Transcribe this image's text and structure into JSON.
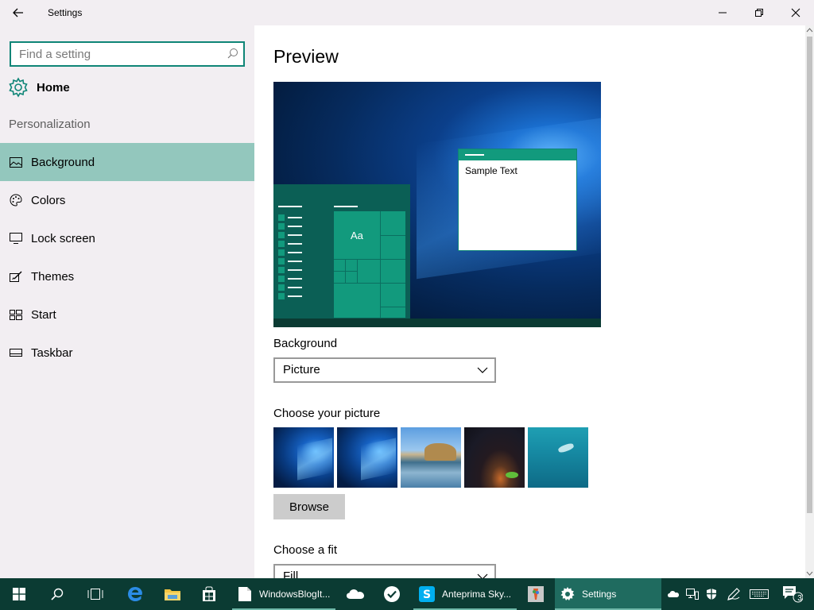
{
  "window": {
    "title": "Settings",
    "back_icon": "back-arrow-icon",
    "minimize_icon": "minimize-icon",
    "restore_icon": "restore-icon",
    "close_icon": "close-icon"
  },
  "sidebar": {
    "search_placeholder": "Find a setting",
    "home_label": "Home",
    "section_title": "Personalization",
    "items": [
      {
        "label": "Background",
        "icon": "picture-icon",
        "active": true
      },
      {
        "label": "Colors",
        "icon": "palette-icon",
        "active": false
      },
      {
        "label": "Lock screen",
        "icon": "monitor-icon",
        "active": false
      },
      {
        "label": "Themes",
        "icon": "brush-icon",
        "active": false
      },
      {
        "label": "Start",
        "icon": "start-tiles-icon",
        "active": false
      },
      {
        "label": "Taskbar",
        "icon": "taskbar-icon",
        "active": false
      }
    ]
  },
  "main": {
    "heading": "Preview",
    "preview_sample_text": "Sample Text",
    "preview_tile_text": "Aa",
    "background_label": "Background",
    "background_value": "Picture",
    "choose_picture_label": "Choose your picture",
    "browse_label": "Browse",
    "choose_fit_label": "Choose a fit",
    "fit_value": "Fill"
  },
  "taskbar": {
    "apps": [
      {
        "label": "WindowsBlogIt...",
        "icon": "document-icon"
      },
      {
        "label": "Anteprima Sky...",
        "icon": "skype-icon"
      },
      {
        "label": "Settings",
        "icon": "gear-icon"
      }
    ],
    "notification_count": "3"
  },
  "colors": {
    "accent": "#0f8577",
    "active_nav": "#93c7bd",
    "taskbar": "#0b3b33"
  }
}
